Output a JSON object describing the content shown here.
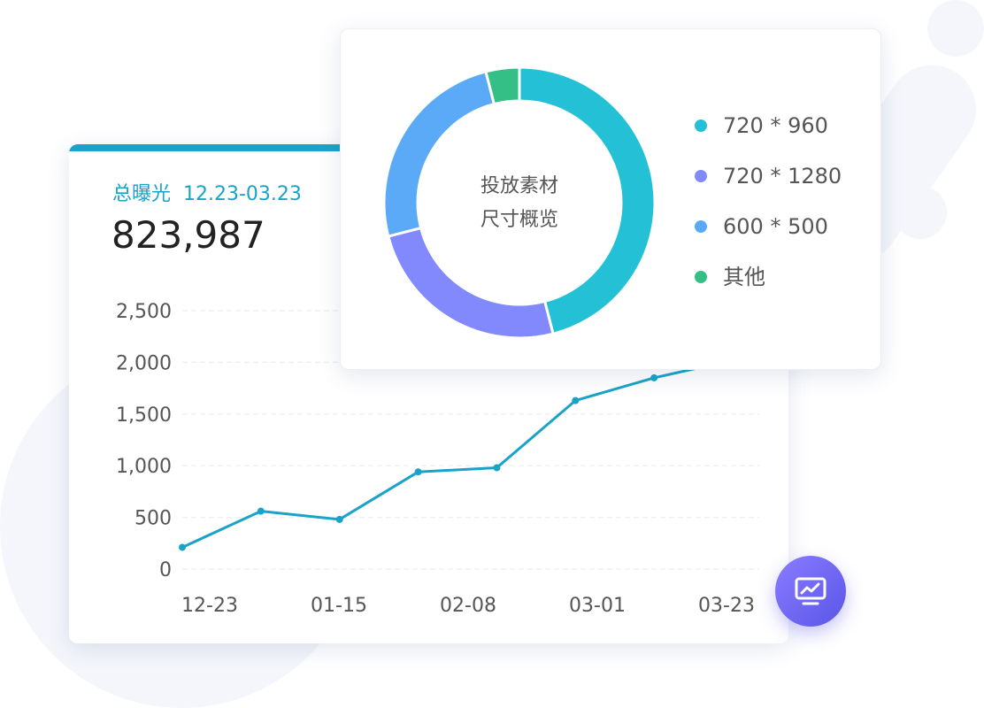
{
  "exposure_card": {
    "label": "总曝光",
    "date_range": "12.23-03.23",
    "total": "823,987"
  },
  "size_card": {
    "center_line1": "投放素材",
    "center_line2": "尺寸概览"
  },
  "fab": {
    "icon": "trend-chart-icon"
  },
  "colors": {
    "accent": "#1aa3c8",
    "teal": "#24c1d6",
    "purple": "#8189fc",
    "blue": "#5aaaf8",
    "green": "#33bf85"
  },
  "chart_data": [
    {
      "type": "line",
      "x_tick_labels": [
        "12-23",
        "01-15",
        "02-08",
        "03-01",
        "03-23"
      ],
      "y_tick_labels": [
        "2,500",
        "2,000",
        "1,500",
        "1,000",
        "500",
        "0"
      ],
      "ylim": [
        0,
        2500
      ],
      "y_ticks": [
        0,
        500,
        1000,
        1500,
        2000,
        2500
      ],
      "grid": true,
      "series": [
        {
          "color": "#1aa3c8",
          "values": [
            210,
            560,
            480,
            940,
            980,
            1630,
            1850,
            2020
          ]
        }
      ]
    },
    {
      "type": "pie",
      "donut": true,
      "legend_position": "right",
      "slices": [
        {
          "label": "720 * 960",
          "value": 46,
          "color": "#24c1d6"
        },
        {
          "label": "720 * 1280",
          "value": 25,
          "color": "#8189fc"
        },
        {
          "label": "600 * 500",
          "value": 25,
          "color": "#5aaaf8"
        },
        {
          "label": "其他",
          "value": 4,
          "color": "#33bf85"
        }
      ]
    }
  ]
}
